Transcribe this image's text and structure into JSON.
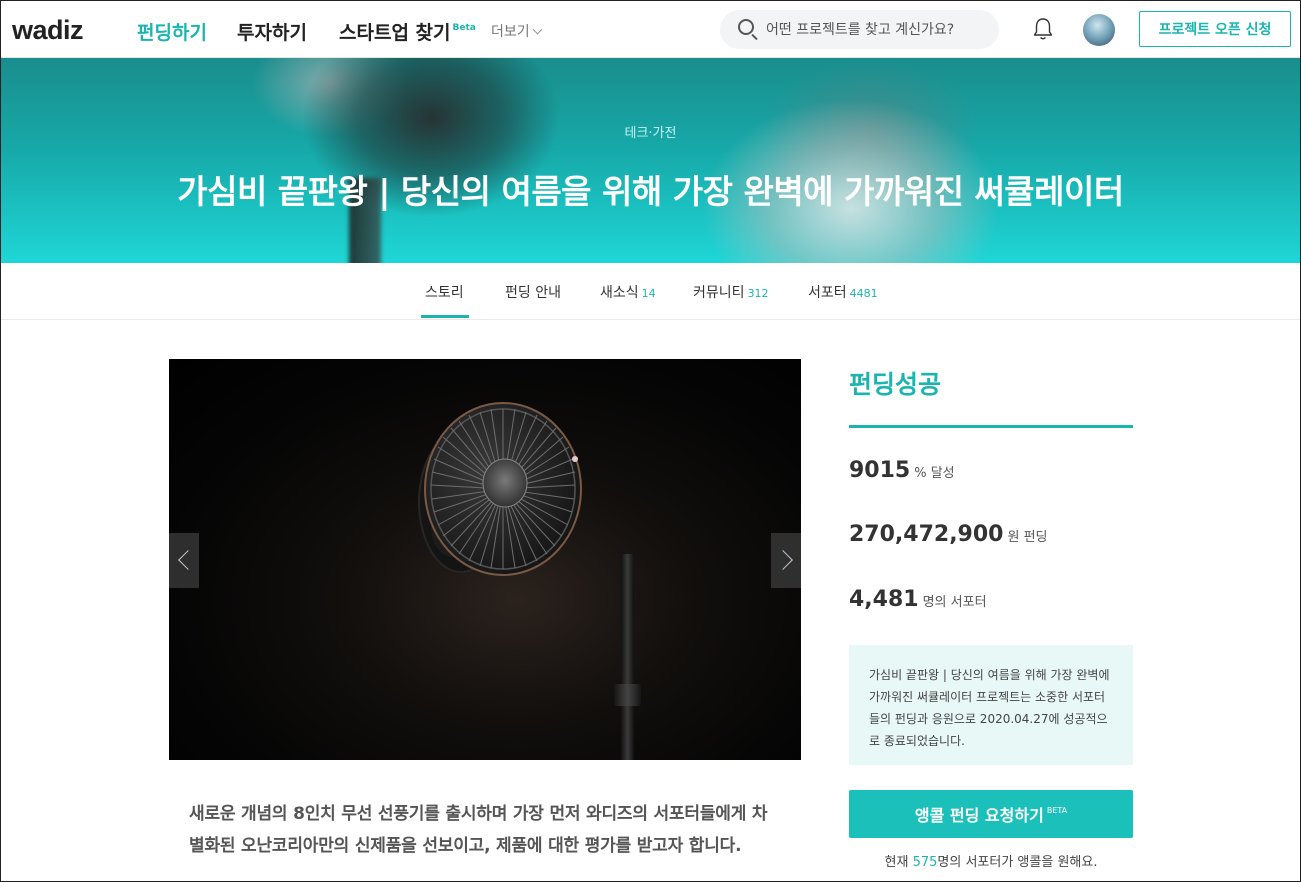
{
  "nav": {
    "logo": "wadiz",
    "items": [
      {
        "label": "펀딩하기",
        "active": true
      },
      {
        "label": "투자하기",
        "active": false
      },
      {
        "label": "스타트업 찾기",
        "badge": "Beta",
        "active": false
      }
    ],
    "more_label": "더보기",
    "search_placeholder": "어떤 프로젝트를 찾고 계신가요?",
    "open_button": "프로젝트 오픈 신청",
    "icons": [
      "search-icon",
      "bell-icon",
      "chevron-down-icon"
    ]
  },
  "hero": {
    "category": "테크·가전",
    "title": "가심비 끝판왕 | 당신의 여름을 위해 가장 완벽에 가까워진 써큘레이터"
  },
  "tabs": [
    {
      "label": "스토리",
      "count": "",
      "active": true
    },
    {
      "label": "펀딩 안내",
      "count": ""
    },
    {
      "label": "새소식",
      "count": "14"
    },
    {
      "label": "커뮤니티",
      "count": "312"
    },
    {
      "label": "서포터",
      "count": "4481"
    }
  ],
  "intro": "새로운 개념의 8인치 무선 선풍기를 출시하며 가장 먼저 와디즈의 서포터들에게 차별화된 오난코리아만의 신제품을 선보이고, 제품에 대한 평가를 받고자 합니다.",
  "sidebar": {
    "status": "펀딩성공",
    "achievement": {
      "value": "9015",
      "unit": "% 달성"
    },
    "amount": {
      "value": "270,472,900",
      "unit": "원 펀딩"
    },
    "supporters": {
      "value": "4,481",
      "unit": "명의 서포터"
    },
    "notice": "가심비 끝판왕 | 당신의 여름을 위해 가장 완벽에 가까워진 써큘레이터 프로젝트는 소중한 서포터들의 펀딩과 응원으로 2020.04.27에 성공적으로 종료되었습니다.",
    "encore_button": "앵콜 펀딩 요청하기",
    "encore_badge": "BETA",
    "encore_prefix": "현재 ",
    "encore_count": "575",
    "encore_suffix": "명의 서포터가 앵콜을 원해요."
  },
  "colors": {
    "accent": "#1bb5b0",
    "button": "#1bc0bb",
    "notice_bg": "#e8f8f6"
  }
}
